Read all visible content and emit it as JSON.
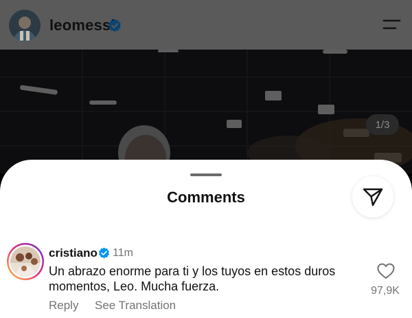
{
  "post_header": {
    "username": "leomessi",
    "verified_icon": "verified-badge-icon",
    "menu_icon": "hamburger-menu-icon"
  },
  "photo": {
    "page_indicator": "1/3"
  },
  "comments_sheet": {
    "title": "Comments",
    "share_icon": "send-icon"
  },
  "comment": {
    "username": "cristiano",
    "time": "11m",
    "text": "Un abrazo enorme para ti y los tuyos en estos duros momentos, Leo. Mucha fuerza.",
    "reply_label": "Reply",
    "translation_label": "See Translation",
    "like_count": "97,9K",
    "like_icon": "heart-outline-icon"
  },
  "colors": {
    "verified_blue": "#0095F6",
    "secondary_text": "#737373",
    "story_ring": [
      "#F9CE34",
      "#EE2A7B",
      "#6228D7"
    ]
  }
}
